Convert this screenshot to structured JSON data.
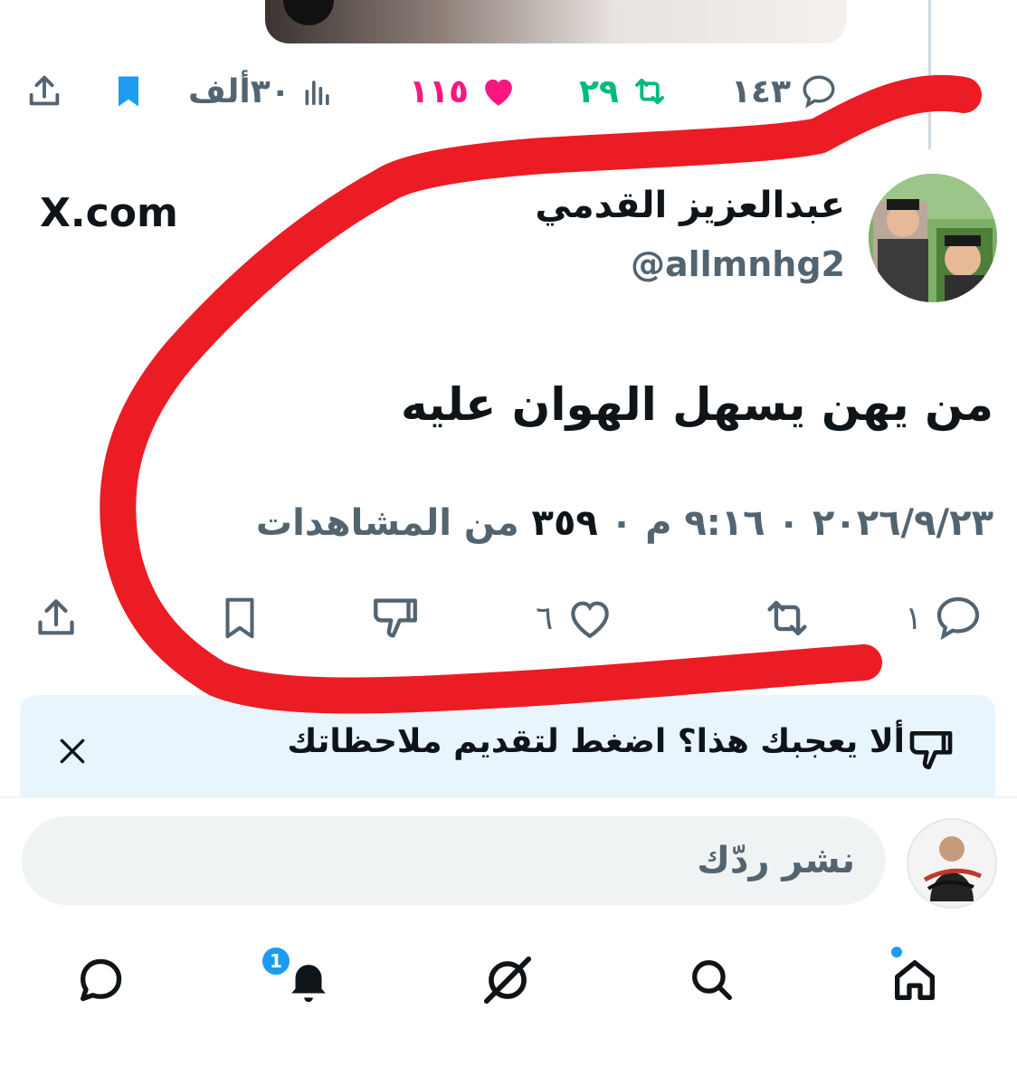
{
  "top_actions": {
    "replies": "١٤٣",
    "reposts": "٢٩",
    "likes": "١١٥",
    "views": "٣٠ألف"
  },
  "post": {
    "author_name": "عبدالعزيز القدمي",
    "author_handle": "@allmnhg2",
    "source": "X.com",
    "text": "من يهن يسهل الهوان عليه",
    "timestamp": "٢٠٢٦/٩/٢٣ ٠ ٩:١٦ م ٠",
    "views_count": "٣٥٩",
    "views_label": "من المشاهدات"
  },
  "actions": {
    "replies": "١",
    "likes": "٦"
  },
  "feedback_banner": {
    "text": "ألا يعجبك هذا؟ اضغط لتقديم ملاحظاتك"
  },
  "reply": {
    "placeholder": "نشر ردّك"
  },
  "nav": {
    "notifications_badge": "1"
  },
  "colors": {
    "accent": "#1d9bf0",
    "repost_green": "#00ba7c",
    "like_pink": "#f91880",
    "annotation_red": "#ec1c24",
    "muted_text": "#536471"
  }
}
